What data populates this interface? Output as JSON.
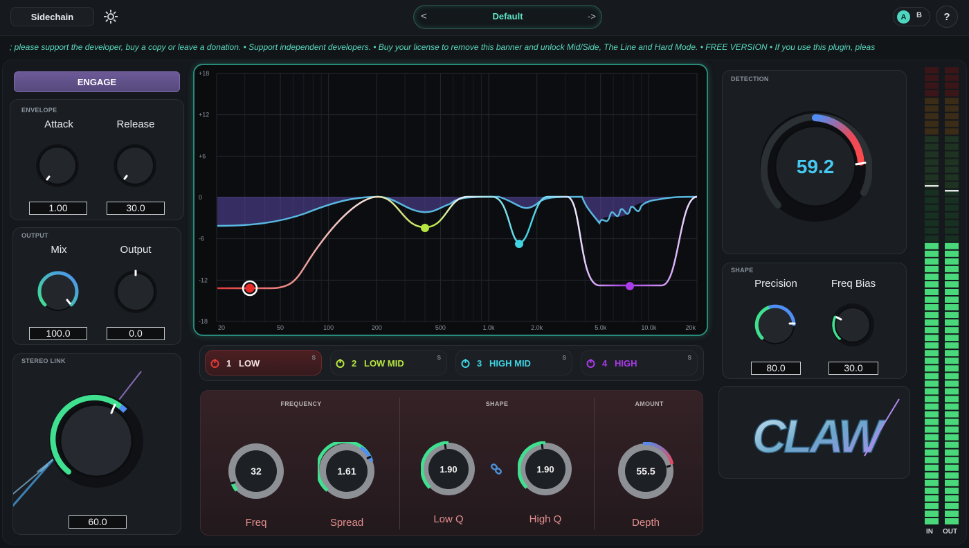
{
  "header": {
    "sidechain_label": "Sidechain",
    "preset_prev": "<",
    "preset_name": "Default",
    "preset_next": "->",
    "ab_a": "A",
    "ab_b": "B",
    "help": "?"
  },
  "banner_text": "; please support the developer, buy a copy or leave a donation.  •  Support independent developers.  •  Buy your license to remove this banner and unlock Mid/Side, The Line and Hard Mode.  •  FREE VERSION  •  If you use this plugin, pleas",
  "left": {
    "engage_label": "ENGAGE",
    "envelope": {
      "title": "ENVELOPE",
      "attack_label": "Attack",
      "attack_value": "1.00",
      "release_label": "Release",
      "release_value": "30.0"
    },
    "output": {
      "title": "OUTPUT",
      "mix_label": "Mix",
      "mix_value": "100.0",
      "output_label": "Output",
      "output_value": "0.0"
    },
    "stereo_link": {
      "title": "STEREO LINK",
      "value": "60.0"
    }
  },
  "graph": {
    "y_labels": [
      "+18",
      "+12",
      "+6",
      "0",
      "-6",
      "-12",
      "-18"
    ],
    "x_labels": [
      "20",
      "50",
      "100",
      "200",
      "500",
      "1.0k",
      "2.0k",
      "5.0k",
      "10.0k",
      "20k"
    ]
  },
  "bands": [
    {
      "num": "1",
      "label": "LOW",
      "solo": "S",
      "color": "#e23a3a"
    },
    {
      "num": "2",
      "label": "LOW MID",
      "solo": "S",
      "color": "#b8e640"
    },
    {
      "num": "3",
      "label": "HIGH MID",
      "solo": "S",
      "color": "#3fd3e3"
    },
    {
      "num": "4",
      "label": "HIGH",
      "solo": "S",
      "color": "#a93be8"
    }
  ],
  "params": {
    "frequency_title": "FREQUENCY",
    "shape_title": "SHAPE",
    "amount_title": "AMOUNT",
    "freq": {
      "label": "Freq",
      "value": "32"
    },
    "spread": {
      "label": "Spread",
      "value": "1.61"
    },
    "low_q": {
      "label": "Low Q",
      "value": "1.90"
    },
    "high_q": {
      "label": "High Q",
      "value": "1.90"
    },
    "depth": {
      "label": "Depth",
      "value": "55.5"
    }
  },
  "right": {
    "detection": {
      "title": "DETECTION",
      "value": "59.2"
    },
    "shape": {
      "title": "SHAPE",
      "precision_label": "Precision",
      "precision_value": "80.0",
      "freq_bias_label": "Freq Bias",
      "freq_bias_value": "30.0"
    },
    "logo_text": "CLAW"
  },
  "meters": {
    "in_label": "IN",
    "out_label": "OUT"
  },
  "colors": {
    "accent": "#4fd6c0",
    "low": "#e23a3a",
    "low_mid": "#b8e640",
    "high_mid": "#3fd3e3",
    "high": "#a93be8"
  }
}
